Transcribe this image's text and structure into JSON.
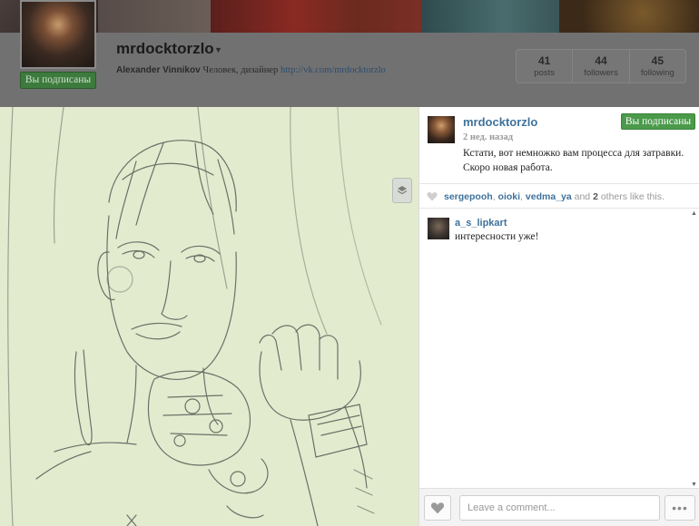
{
  "profile": {
    "username": "mrdocktorzlo",
    "full_name": "Alexander Vinnikov",
    "bio": "Человек, дизайнер",
    "link": "http://vk.com/mrdocktorzlo",
    "follow_button": "Вы подписаны",
    "stats": [
      {
        "num": "41",
        "label": "posts"
      },
      {
        "num": "44",
        "label": "followers"
      },
      {
        "num": "45",
        "label": "following"
      }
    ]
  },
  "post": {
    "username": "mrdocktorzlo",
    "follow_button": "Вы подписаны",
    "time": "2 нед. назад",
    "caption": "Кстати, вот немножко вам процесса для затравки. Скоро новая работа.",
    "likes": {
      "likers": [
        "sergepooh",
        "oioki",
        "vedma_ya"
      ],
      "and_word": "and",
      "others_count": "2",
      "others_suffix": "others like this."
    },
    "comments": [
      {
        "user": "a_s_lipkart",
        "text": "интересности уже!"
      }
    ],
    "comment_placeholder": "Leave a comment...",
    "more_label": "•••"
  },
  "colors": {
    "link_blue": "#3f729b",
    "follow_green": "#4b9a4b",
    "sketch_bg": "#e3ebcf"
  },
  "icons": {
    "heart": "heart-icon",
    "layers": "layers-icon",
    "more": "more-icon",
    "caret": "chevron-down-icon"
  }
}
